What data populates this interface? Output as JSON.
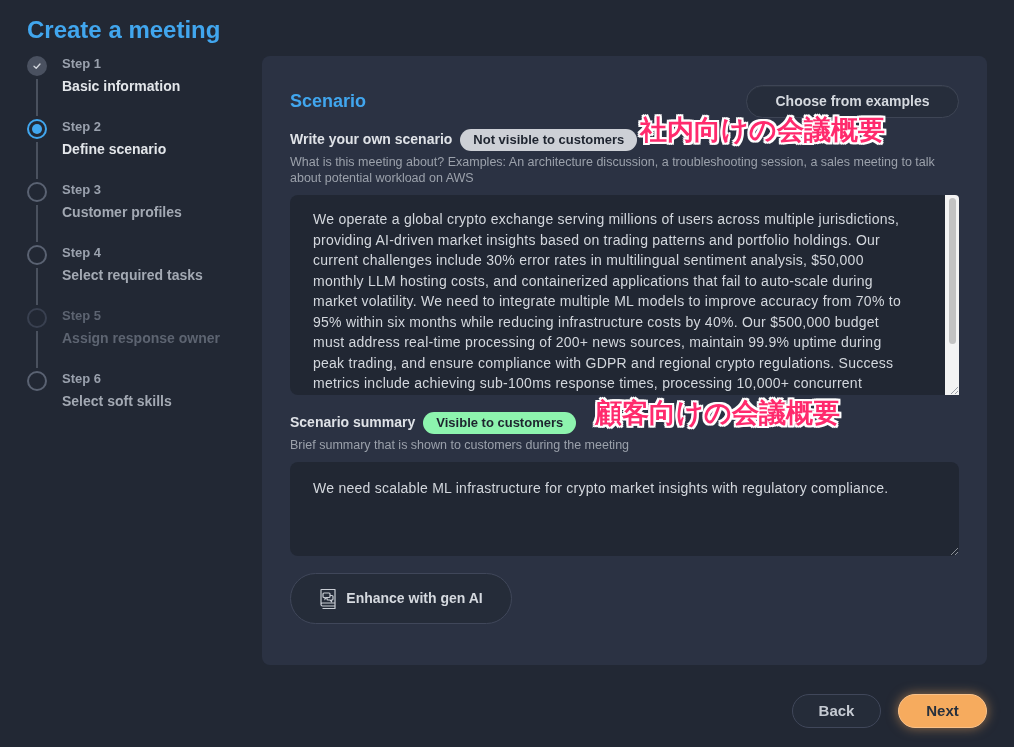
{
  "title": "Create a meeting",
  "steps": [
    {
      "step": "Step 1",
      "label": "Basic information",
      "completed": true,
      "selected": false,
      "disabled": false
    },
    {
      "step": "Step 2",
      "label": "Define scenario",
      "completed": false,
      "selected": true,
      "disabled": false
    },
    {
      "step": "Step 3",
      "label": "Customer profiles",
      "completed": false,
      "selected": false,
      "disabled": false
    },
    {
      "step": "Step 4",
      "label": "Select required tasks",
      "completed": false,
      "selected": false,
      "disabled": false
    },
    {
      "step": "Step 5",
      "label": "Assign response owner",
      "completed": false,
      "selected": false,
      "disabled": true
    },
    {
      "step": "Step 6",
      "label": "Select soft skills",
      "completed": false,
      "selected": false,
      "disabled": false
    }
  ],
  "panel": {
    "heading": "Scenario",
    "examples_button": "Choose from examples",
    "fields": [
      {
        "kind": "scenario",
        "label": "Write your own scenario",
        "badge": {
          "text": "Not visible to customers",
          "color": "#cdd0d6"
        },
        "hint": "What is this meeting about? Examples: An architecture discussion, a troubleshooting session, a sales meeting to talk about potential workload on AWS",
        "value": "We operate a global crypto exchange serving millions of users across multiple jurisdictions, providing AI-driven market insights based on trading patterns and portfolio holdings. Our current challenges include 30% error rates in multilingual sentiment analysis, $50,000 monthly LLM hosting costs, and containerized applications that fail to auto-scale during market volatility. We need to integrate multiple ML models to improve accuracy from 70% to 95% within six months while reducing infrastructure costs by 40%. Our $500,000 budget must address real-time processing of 200+ news sources, maintain 99.9% uptime during peak trading, and ensure compliance with GDPR and regional crypto regulations. Success metrics include achieving sub-100ms response times, processing 10,000+ concurrent"
      },
      {
        "kind": "summary",
        "label": "Scenario summary",
        "badge": {
          "text": "Visible to customers",
          "color": "#8df4ae"
        },
        "hint": "Brief summary that is shown to customers during the meeting",
        "value": "We need scalable ML infrastructure for crypto market insights with regulatory compliance."
      }
    ],
    "enhance_button": "Enhance with gen AI"
  },
  "annotations": [
    {
      "text": "社内向けの会議概要"
    },
    {
      "text": "顧客向けの会議概要"
    }
  ],
  "footer": {
    "back": "Back",
    "next": "Next"
  }
}
